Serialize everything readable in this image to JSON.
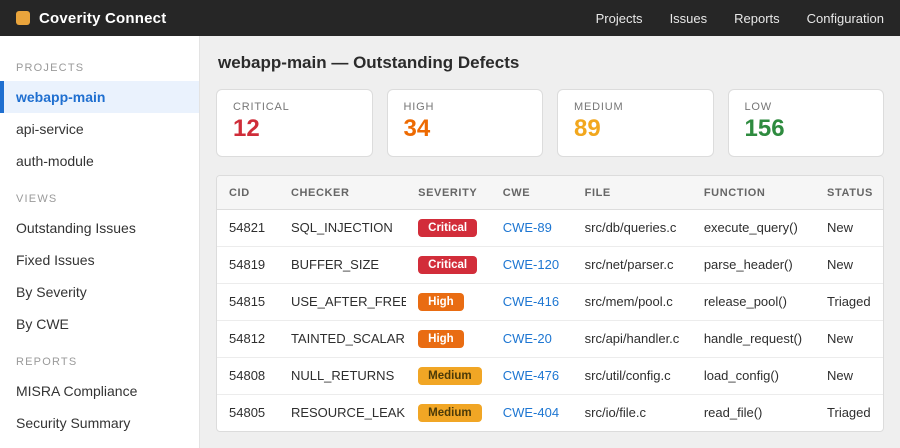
{
  "topbar": {
    "brand": "Coverity Connect",
    "nav": [
      {
        "label": "Projects"
      },
      {
        "label": "Issues"
      },
      {
        "label": "Reports"
      },
      {
        "label": "Configuration"
      }
    ]
  },
  "sidebar": {
    "sections": [
      {
        "title": "PROJECTS",
        "key": "projects",
        "items": [
          {
            "label": "webapp-main",
            "active": true
          },
          {
            "label": "api-service",
            "active": false
          },
          {
            "label": "auth-module",
            "active": false
          }
        ]
      },
      {
        "title": "VIEWS",
        "key": "views",
        "items": [
          {
            "label": "Outstanding Issues",
            "active": false
          },
          {
            "label": "Fixed Issues",
            "active": false
          },
          {
            "label": "By Severity",
            "active": false
          },
          {
            "label": "By CWE",
            "active": false
          }
        ]
      },
      {
        "title": "REPORTS",
        "key": "reports",
        "items": [
          {
            "label": "MISRA Compliance",
            "active": false
          },
          {
            "label": "Security Summary",
            "active": false
          }
        ]
      }
    ]
  },
  "main": {
    "title": "webapp-main — Outstanding Defects",
    "stats": [
      {
        "label": "CRITICAL",
        "value": "12",
        "color": "#cf2d39"
      },
      {
        "label": "HIGH",
        "value": "34",
        "color": "#ed6a02"
      },
      {
        "label": "MEDIUM",
        "value": "89",
        "color": "#f2a71d"
      },
      {
        "label": "LOW",
        "value": "156",
        "color": "#2e8b3f"
      }
    ],
    "table": {
      "columns": [
        "CID",
        "CHECKER",
        "SEVERITY",
        "CWE",
        "FILE",
        "FUNCTION",
        "STATUS"
      ],
      "rows": [
        {
          "cid": "54821",
          "checker": "SQL_INJECTION",
          "severity": "Critical",
          "cwe": "CWE-89",
          "file": "src/db/queries.c",
          "function": "execute_query()",
          "status": "New"
        },
        {
          "cid": "54819",
          "checker": "BUFFER_SIZE",
          "severity": "Critical",
          "cwe": "CWE-120",
          "file": "src/net/parser.c",
          "function": "parse_header()",
          "status": "New"
        },
        {
          "cid": "54815",
          "checker": "USE_AFTER_FREE",
          "severity": "High",
          "cwe": "CWE-416",
          "file": "src/mem/pool.c",
          "function": "release_pool()",
          "status": "Triaged"
        },
        {
          "cid": "54812",
          "checker": "TAINTED_SCALAR",
          "severity": "High",
          "cwe": "CWE-20",
          "file": "src/api/handler.c",
          "function": "handle_request()",
          "status": "New"
        },
        {
          "cid": "54808",
          "checker": "NULL_RETURNS",
          "severity": "Medium",
          "cwe": "CWE-476",
          "file": "src/util/config.c",
          "function": "load_config()",
          "status": "New"
        },
        {
          "cid": "54805",
          "checker": "RESOURCE_LEAK",
          "severity": "Medium",
          "cwe": "CWE-404",
          "file": "src/io/file.c",
          "function": "read_file()",
          "status": "Triaged"
        }
      ]
    }
  },
  "colors": {
    "topbar_bg": "#262626",
    "logo_orange": "#e9a43c",
    "active_item_blue": "#1f6fd0",
    "badge_critical": "#d22d3a",
    "badge_high": "#e96c12",
    "badge_medium": "#f1a625",
    "link_blue": "#1d76d2"
  }
}
